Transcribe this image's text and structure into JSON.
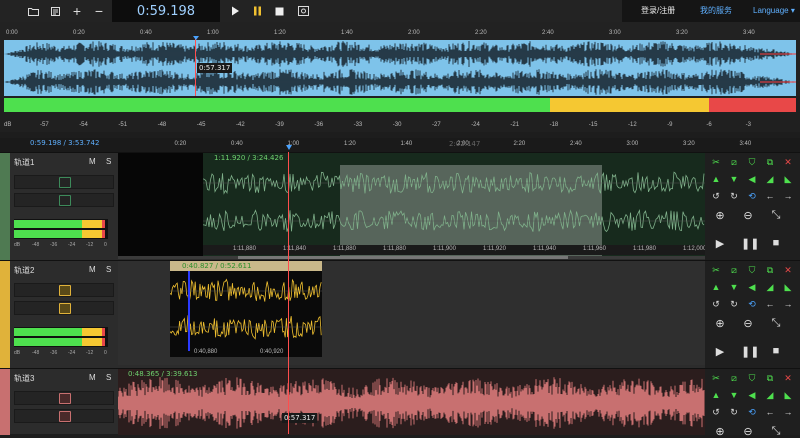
{
  "toolbar": {
    "icons": [
      "folder-open-icon",
      "list-icon",
      "plus-icon",
      "minus-icon",
      "play-icon",
      "pause-icon",
      "stop-icon",
      "loop-icon"
    ],
    "time": "0:59.198",
    "login_label": "登录/注册",
    "service_label": "我的服务",
    "language_label": "Language"
  },
  "overview": {
    "ruler": [
      "0:00",
      "0:20",
      "0:40",
      "1:00",
      "1:20",
      "1:40",
      "2:00",
      "2:20",
      "2:40",
      "3:00",
      "3:20",
      "3:40"
    ],
    "cursor_time": "0:57.317",
    "color": "#7ec3ea"
  },
  "meter": {
    "labels": [
      "dB",
      "-57",
      "-54",
      "-51",
      "-48",
      "-45",
      "-42",
      "-39",
      "-36",
      "-33",
      "-30",
      "-27",
      "-24",
      "-21",
      "-18",
      "-15",
      "-12",
      "-9",
      "-6",
      "-3"
    ],
    "levels": {
      "green_end": 0.69,
      "yellow_end": 0.89
    },
    "colors": {
      "green": "#4ee04e",
      "yellow": "#f5c832",
      "red": "#e84848"
    }
  },
  "timeline": {
    "position": "0:59.198 / 3:53.742",
    "ruler": [
      "0:00",
      "0:20",
      "0:40",
      "1:00",
      "1:20",
      "1:40",
      "2:00",
      "2:20",
      "2:40",
      "3:00",
      "3:20",
      "3:40"
    ],
    "ghost_time": "2:02.147"
  },
  "tracks": [
    {
      "name": "轨道1",
      "m": "M",
      "s": "S",
      "color": "#4f7a52",
      "clip_time": "1:11.920 / 3:24.426",
      "clip_ruler": [
        "1:11,880",
        "1:11,840",
        "1:11,880",
        "1:11,880",
        "1:11,900",
        "1:11,920",
        "1:11,940",
        "1:11,960",
        "1:11,980",
        "1:12,000"
      ]
    },
    {
      "name": "轨道2",
      "m": "M",
      "s": "S",
      "color": "#e0b23a",
      "clip_time": "0:40.827 / 0:52.611",
      "clip_ruler": [
        "0:40,880",
        "0:40,920"
      ]
    },
    {
      "name": "轨道3",
      "m": "M",
      "s": "S",
      "color": "#c87070",
      "clip_time": "0:48.365 / 3:39.613",
      "cursor_time": "0:57.317"
    }
  ],
  "vol_labels": [
    "dB",
    "-48",
    "-36",
    "-24",
    "-12",
    "0"
  ],
  "panel_icons": [
    "scissors-icon",
    "crop-icon",
    "shield-icon",
    "copy-icon",
    "delete-icon",
    "volume-up-icon",
    "volume-down-icon",
    "volume-icon",
    "fade-in-icon",
    "fade-out-icon",
    "undo-icon",
    "redo-icon",
    "loop-icon",
    "left-arrow-icon",
    "right-arrow-icon",
    "zoom-in-icon",
    "zoom-out-icon",
    "fit-icon",
    "play-icon",
    "pause-icon",
    "stop-icon"
  ]
}
